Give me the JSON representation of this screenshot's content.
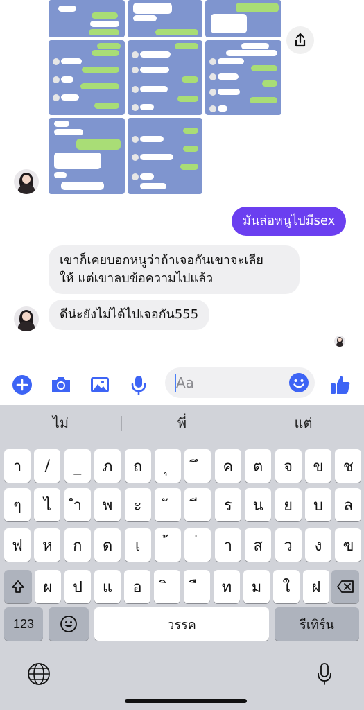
{
  "messages": {
    "outgoing_1": "มันล่อหนูไปมีsex",
    "incoming_1_line1": "เขาก็เคยบอกหนูว่าถ้าเจอกันเขาจะเลีย",
    "incoming_1_line2": "ให้ แต่เขาลบข้อความไปแล้ว",
    "incoming_2": "ดีน่ะยังไม่ได้ไปเจอกัน555"
  },
  "composer": {
    "placeholder": "Aa"
  },
  "keyboard": {
    "suggestions": [
      "ไม่",
      "พี่",
      "แต่"
    ],
    "row1": [
      "า",
      "/",
      "_",
      "ภ",
      "ถ",
      "ุ",
      "ึ",
      "ค",
      "ต",
      "จ",
      "ข",
      "ช"
    ],
    "row2": [
      "ๆ",
      "ไ",
      "ำ",
      "พ",
      "ะ",
      "ั",
      "ี",
      "ร",
      "น",
      "ย",
      "บ",
      "ล"
    ],
    "row3": [
      "ฟ",
      "ห",
      "ก",
      "ด",
      "เ",
      "้",
      "่",
      "า",
      "ส",
      "ว",
      "ง",
      "ฃ"
    ],
    "row4": [
      "ผ",
      "ป",
      "แ",
      "อ",
      "ิ",
      "ื",
      "ท",
      "ม",
      "ใ",
      "ฝ"
    ],
    "numbers_label": "123",
    "space_label": "วรรค",
    "return_label": "รีเทิร์น"
  },
  "colors": {
    "accent": "#6b3ff0",
    "icon_blue": "#3d64f5",
    "incoming_bubble": "#efeff1"
  }
}
